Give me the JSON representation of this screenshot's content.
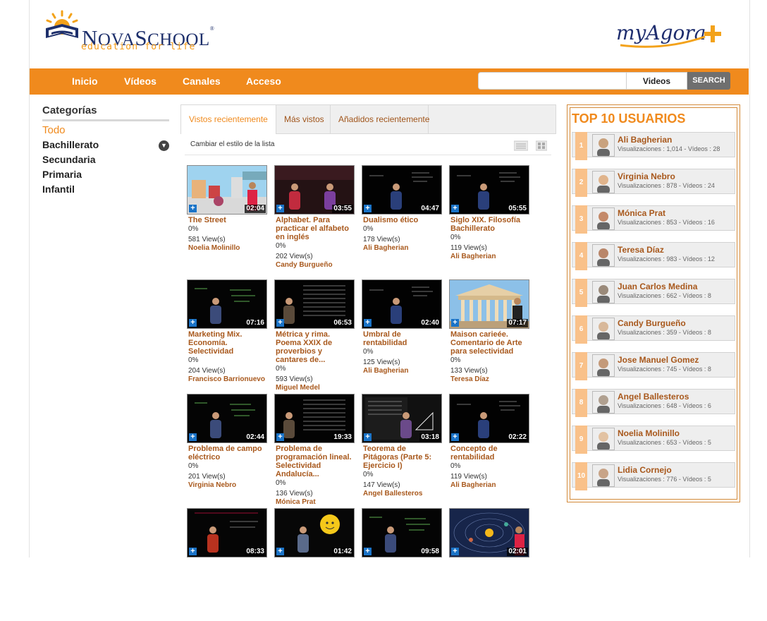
{
  "brand": {
    "name_first": "N",
    "name_rest": "OVA",
    "name_first2": "S",
    "name_rest2": "CHOOL",
    "reg": "®",
    "tagline": "education for life",
    "partner": "myAgora"
  },
  "nav": {
    "items": [
      "Inicio",
      "Vídeos",
      "Canales",
      "Acceso"
    ],
    "search_placeholder": "",
    "search_scope": "Videos",
    "search_button": "SEARCH"
  },
  "sidebar": {
    "title": "Categorías",
    "items": [
      "Todo",
      "Bachillerato",
      "Secundaria",
      "Primaria",
      "Infantil"
    ],
    "active": "Todo"
  },
  "tabs": {
    "items": [
      "Vistos recientemente",
      "Más vistos",
      "Añadidos recientemente"
    ],
    "active": "Vistos recientemente"
  },
  "list_style_label": "Cambiar el estilo de la lista",
  "videos": [
    {
      "title": "The Street",
      "rating": "0%",
      "views": "581 View(s)",
      "user": "Noelia Molinillo",
      "duration": "02:04",
      "thumb": "street"
    },
    {
      "title": "Alphabet. Para practicar el alfabeto en inglés",
      "rating": "0%",
      "views": "202 View(s)",
      "user": "Candy Burgueño",
      "duration": "03:55",
      "thumb": "studio2"
    },
    {
      "title": "Dualismo ético",
      "rating": "0%",
      "views": "178 View(s)",
      "user": "Ali Bagherian",
      "duration": "04:47",
      "thumb": "board"
    },
    {
      "title": "Siglo XIX. Filosofía Bachillerato",
      "rating": "0%",
      "views": "119 View(s)",
      "user": "Ali Bagherian",
      "duration": "05:55",
      "thumb": "board"
    },
    {
      "title": "Marketing Mix. Economía. Selectividad",
      "rating": "0%",
      "views": "204 View(s)",
      "user": "Francisco Barrionuevo",
      "duration": "07:16",
      "thumb": "green"
    },
    {
      "title": "Métrica y rima. Poema XXIX de proverbios y cantares de...",
      "rating": "0%",
      "views": "593 View(s)",
      "user": "Miguel Medel",
      "duration": "06:53",
      "thumb": "text"
    },
    {
      "title": "Umbral de rentabilidad",
      "rating": "0%",
      "views": "125 View(s)",
      "user": "Ali Bagherian",
      "duration": "02:40",
      "thumb": "board"
    },
    {
      "title": "Maison carieée. Comentario de Arte para selectividad",
      "rating": "0%",
      "views": "133 View(s)",
      "user": "Teresa Díaz",
      "duration": "07:17",
      "thumb": "temple"
    },
    {
      "title": "Problema de campo eléctrico",
      "rating": "0%",
      "views": "201 View(s)",
      "user": "Virginia Nebro",
      "duration": "02:44",
      "thumb": "green"
    },
    {
      "title": "Problema de programación lineal. Selectividad Andalucía...",
      "rating": "0%",
      "views": "136 View(s)",
      "user": "Mónica Prat",
      "duration": "19:33",
      "thumb": "text"
    },
    {
      "title": "Teorema de Pitágoras (Parte 5: Ejercicio I)",
      "rating": "0%",
      "views": "147 View(s)",
      "user": "Angel Ballesteros",
      "duration": "03:18",
      "thumb": "slide"
    },
    {
      "title": "Concepto de rentabilidad",
      "rating": "0%",
      "views": "119 View(s)",
      "user": "Ali Bagherian",
      "duration": "02:22",
      "thumb": "board"
    },
    {
      "title": "",
      "rating": "",
      "views": "",
      "user": "",
      "duration": "08:33",
      "thumb": "redshirt"
    },
    {
      "title": "",
      "rating": "",
      "views": "",
      "user": "",
      "duration": "01:42",
      "thumb": "sun"
    },
    {
      "title": "",
      "rating": "",
      "views": "",
      "user": "",
      "duration": "09:58",
      "thumb": "green"
    },
    {
      "title": "",
      "rating": "",
      "views": "",
      "user": "",
      "duration": "02:01",
      "thumb": "space"
    }
  ],
  "top10": {
    "title": "TOP 10 USUARIOS",
    "users": [
      {
        "rank": "1",
        "name": "Ali Bagherian",
        "stats": "Visualizaciones : 1,014 - Vídeos : 28"
      },
      {
        "rank": "2",
        "name": "Virginia Nebro",
        "stats": "Visualizaciones : 878 - Vídeos : 24"
      },
      {
        "rank": "3",
        "name": "Mónica Prat",
        "stats": "Visualizaciones : 853 - Vídeos : 16"
      },
      {
        "rank": "4",
        "name": "Teresa Díaz",
        "stats": "Visualizaciones : 983 - Vídeos : 12"
      },
      {
        "rank": "5",
        "name": "Juan Carlos Medina",
        "stats": "Visualizaciones : 662 - Vídeos : 8"
      },
      {
        "rank": "6",
        "name": "Candy Burgueño",
        "stats": "Visualizaciones : 359 - Vídeos : 8"
      },
      {
        "rank": "7",
        "name": "Jose Manuel Gomez",
        "stats": "Visualizaciones : 745 - Vídeos : 8"
      },
      {
        "rank": "8",
        "name": "Angel Ballesteros",
        "stats": "Visualizaciones : 648 - Vídeos : 6"
      },
      {
        "rank": "9",
        "name": "Noelia Molinillo",
        "stats": "Visualizaciones : 653 - Vídeos : 5"
      },
      {
        "rank": "10",
        "name": "Lidia Cornejo",
        "stats": "Visualizaciones : 776 - Vídeos : 5"
      }
    ]
  },
  "colors": {
    "accent": "#f08a1d",
    "link": "#a8581c",
    "logo_blue": "#1d2f6b",
    "rank_bg": "#f9c18a"
  }
}
